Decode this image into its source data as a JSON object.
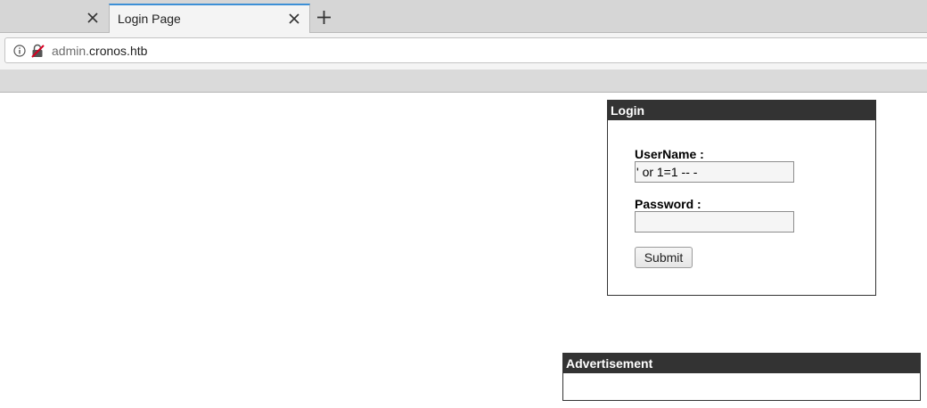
{
  "browser": {
    "tabs": [
      {
        "title": "",
        "active": false
      },
      {
        "title": "Login Page",
        "active": true
      }
    ],
    "url": {
      "subdomain": "admin.",
      "domain": "cronos.htb"
    },
    "icons": {
      "tab_close": "close-icon",
      "new_tab": "plus-icon",
      "site_info": "info-icon",
      "connection": "insecure-connection-icon"
    },
    "accent_color": "#3d8fd6"
  },
  "login": {
    "header": "Login",
    "username_label": "UserName :",
    "username_value": "' or 1=1 -- -",
    "password_label": "Password :",
    "password_value": "",
    "submit_label": "Submit"
  },
  "advertisement": {
    "header": "Advertisement"
  }
}
